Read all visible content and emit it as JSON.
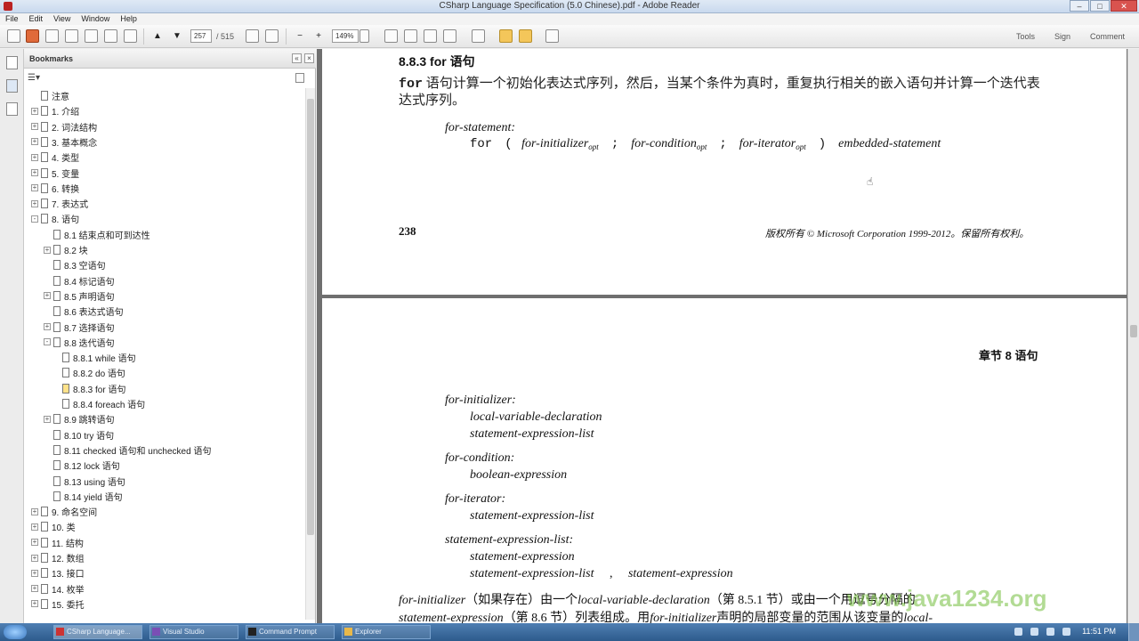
{
  "window": {
    "title": "CSharp Language Specification (5.0 Chinese).pdf - Adobe Reader",
    "controls": [
      "–",
      "□",
      "✕"
    ]
  },
  "menu": [
    "File",
    "Edit",
    "View",
    "Window",
    "Help"
  ],
  "toolbar": {
    "page_current": "257",
    "page_total": "/ 515",
    "zoom": "149%",
    "tools": "Tools",
    "sign": "Sign",
    "comment": "Comment"
  },
  "bookmarks": {
    "title": "Bookmarks",
    "items": [
      {
        "label": "注意",
        "level": 0,
        "expander": "none"
      },
      {
        "label": "1. 介绍",
        "level": 0,
        "expander": "+"
      },
      {
        "label": "2. 词法结构",
        "level": 0,
        "expander": "+"
      },
      {
        "label": "3. 基本概念",
        "level": 0,
        "expander": "+"
      },
      {
        "label": "4. 类型",
        "level": 0,
        "expander": "+"
      },
      {
        "label": "5. 变量",
        "level": 0,
        "expander": "+"
      },
      {
        "label": "6. 转换",
        "level": 0,
        "expander": "+"
      },
      {
        "label": "7. 表达式",
        "level": 0,
        "expander": "+"
      },
      {
        "label": "8. 语句",
        "level": 0,
        "expander": "-"
      },
      {
        "label": "8.1 结束点和可到达性",
        "level": 1,
        "expander": "none"
      },
      {
        "label": "8.2 块",
        "level": 1,
        "expander": "+"
      },
      {
        "label": "8.3 空语句",
        "level": 1,
        "expander": "none"
      },
      {
        "label": "8.4 标记语句",
        "level": 1,
        "expander": "none"
      },
      {
        "label": "8.5 声明语句",
        "level": 1,
        "expander": "+"
      },
      {
        "label": "8.6 表达式语句",
        "level": 1,
        "expander": "none"
      },
      {
        "label": "8.7 选择语句",
        "level": 1,
        "expander": "+"
      },
      {
        "label": "8.8 迭代语句",
        "level": 1,
        "expander": "-"
      },
      {
        "label": "8.8.1 while 语句",
        "level": 2,
        "expander": "none"
      },
      {
        "label": "8.8.2 do 语句",
        "level": 2,
        "expander": "none"
      },
      {
        "label": "8.8.3 for 语句",
        "level": 2,
        "expander": "none",
        "selected": true
      },
      {
        "label": "8.8.4 foreach 语句",
        "level": 2,
        "expander": "none"
      },
      {
        "label": "8.9 跳转语句",
        "level": 1,
        "expander": "+"
      },
      {
        "label": "8.10 try 语句",
        "level": 1,
        "expander": "none"
      },
      {
        "label": "8.11 checked 语句和 unchecked 语句",
        "level": 1,
        "expander": "none"
      },
      {
        "label": "8.12 lock 语句",
        "level": 1,
        "expander": "none"
      },
      {
        "label": "8.13 using 语句",
        "level": 1,
        "expander": "none"
      },
      {
        "label": "8.14 yield 语句",
        "level": 1,
        "expander": "none"
      },
      {
        "label": "9. 命名空间",
        "level": 0,
        "expander": "+"
      },
      {
        "label": "10. 类",
        "level": 0,
        "expander": "+"
      },
      {
        "label": "11. 结构",
        "level": 0,
        "expander": "+"
      },
      {
        "label": "12. 数组",
        "level": 0,
        "expander": "+"
      },
      {
        "label": "13. 接口",
        "level": 0,
        "expander": "+"
      },
      {
        "label": "14. 枚举",
        "level": 0,
        "expander": "+"
      },
      {
        "label": "15. 委托",
        "level": 0,
        "expander": "+"
      }
    ]
  },
  "doc": {
    "section_heading": "8.8.3 for 语句",
    "intro_kw": "for",
    "intro_rest": " 语句计算一个初始化表达式序列，然后，当某个条件为真时，重复执行相关的嵌入语句并计算一个迭代表达式序列。",
    "grammar_name": "for-statement:",
    "g_for": "for",
    "g_lparen": "(",
    "g_init": "for-initializer",
    "g_semi": ";",
    "g_cond": "for-condition",
    "g_iter": "for-iterator",
    "g_opt": "opt",
    "g_rparen": ")",
    "g_embedded": "embedded-statement",
    "page_number": "238",
    "copyright": "版权所有 © Microsoft Corporation 1999-2012。保留所有权利。",
    "chapter_header": "章节 8  语句",
    "init_name": "for-initializer:",
    "init_alt1": "local-variable-declaration",
    "init_alt2": "statement-expression-list",
    "cond_name": "for-condition:",
    "cond_alt1": "boolean-expression",
    "iter_name": "for-iterator:",
    "iter_alt1": "statement-expression-list",
    "sel_name": "statement-expression-list:",
    "sel_alt1": "statement-expression",
    "sel_alt2a": "statement-expression-list",
    "sel_comma": ",",
    "sel_alt2b": "statement-expression",
    "p1_a": "for-initializer",
    "p1_b": "（如果存在）由一个",
    "p1_c": "local-variable-declaration",
    "p1_d": "（第 8.5.1 节）或由一个用逗号分隔的",
    "p2_a": "statement-expression",
    "p2_b": "（第 8.6 节）列表组成。用",
    "p2_c": "for-initializer",
    "p2_d": "声明的局部变量的范围从该变量的",
    "p2_e": "local-",
    "watermark": "www.java1234.org"
  },
  "taskbar": {
    "tasks": [
      "CSharp Language...",
      "Visual Studio",
      "Command Prompt",
      "Explorer"
    ],
    "clock": "11:51 PM"
  }
}
